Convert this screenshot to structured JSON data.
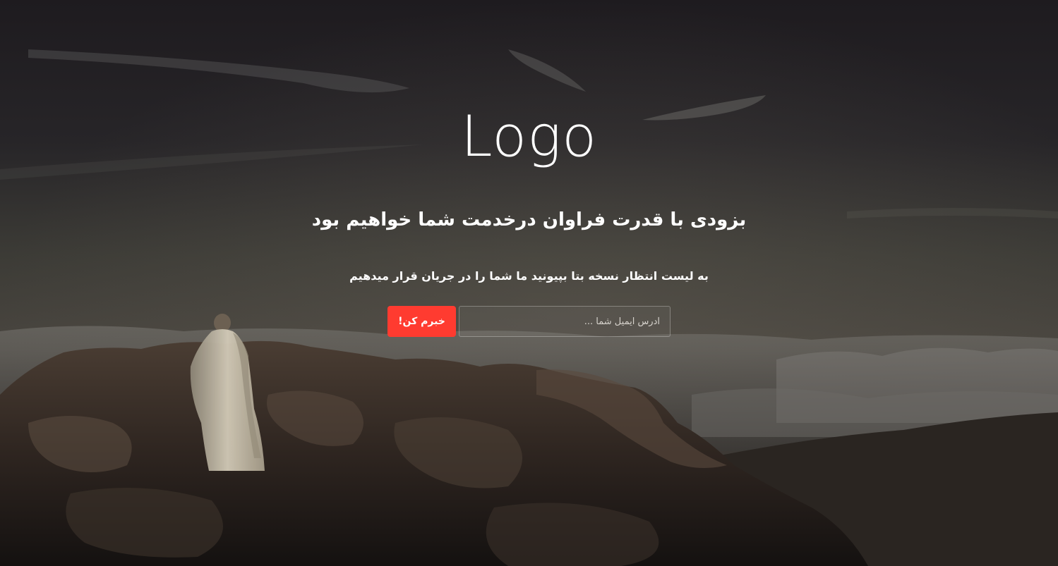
{
  "logo": {
    "text": "Logo"
  },
  "hero": {
    "headline": "بزودی با قدرت فراوان درخدمت شما خواهیم بود",
    "subline": "به لیست انتظار نسخه بتا بپیونید ما شما را در جریان قرار میدهیم"
  },
  "signup": {
    "email_placeholder": "آدرس ایمیل شما ...",
    "email_value": "",
    "button_label": "خبرم کن!"
  },
  "colors": {
    "button_bg": "#ff3b30",
    "text": "#ffffff",
    "sky_dark": "#1c1a1e",
    "sky_horizon": "#4a4740"
  }
}
